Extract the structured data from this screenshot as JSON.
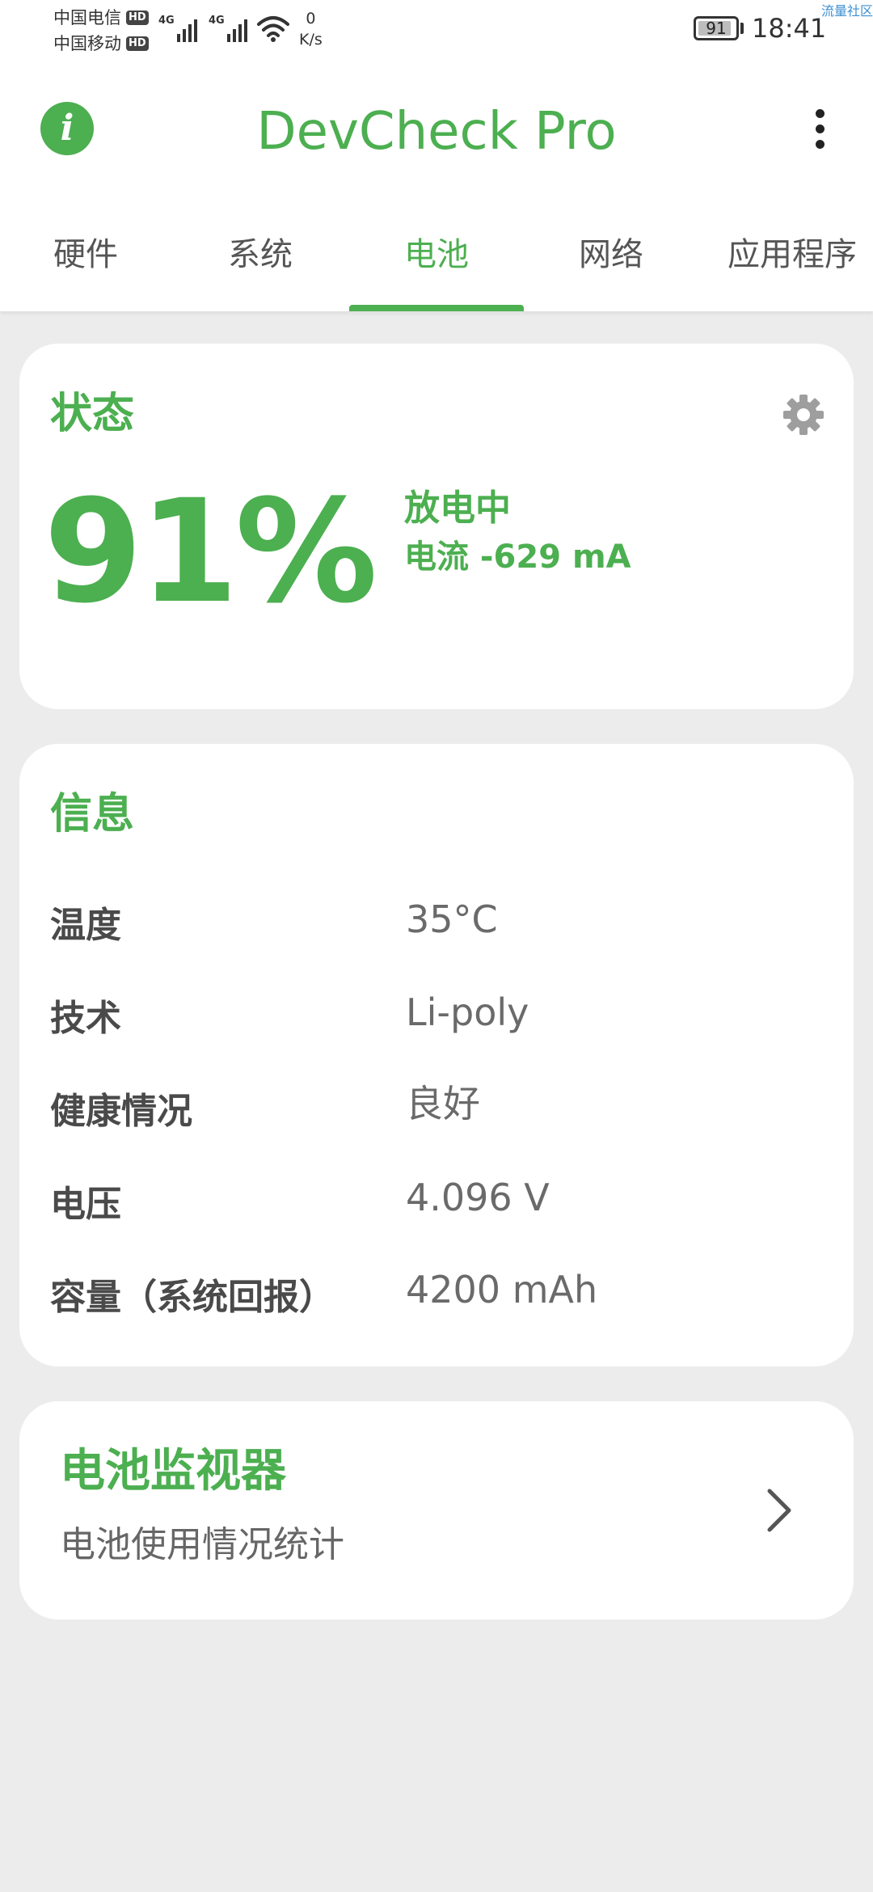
{
  "status_bar": {
    "carrier1": "中国电信",
    "carrier2": "中国移动",
    "hd_badge": "HD",
    "network_type": "4G",
    "net_speed_value": "0",
    "net_speed_unit": "K/s",
    "battery_level": "91",
    "battery_fill_fraction": 0.91,
    "time": "18:41",
    "watermark": "流量社区"
  },
  "app_bar": {
    "title": "DevCheck Pro",
    "info_icon": "info-icon",
    "menu_icon": "more-vert-icon"
  },
  "tabs": [
    {
      "label": "硬件",
      "active": false
    },
    {
      "label": "系统",
      "active": false
    },
    {
      "label": "电池",
      "active": true
    },
    {
      "label": "网络",
      "active": false
    },
    {
      "label": "应用程序",
      "active": false
    }
  ],
  "status_card": {
    "title": "状态",
    "settings_icon": "gear-icon",
    "percent": "91%",
    "state": "放电中",
    "current": "电流 -629 mA"
  },
  "info_card": {
    "title": "信息",
    "rows": [
      {
        "label": "温度",
        "value": "35°C"
      },
      {
        "label": "技术",
        "value": "Li-poly"
      },
      {
        "label": "健康情况",
        "value": "良好"
      },
      {
        "label": "电压",
        "value": "4.096 V"
      },
      {
        "label": "容量（系统回报）",
        "value": "4200 mAh"
      }
    ]
  },
  "monitor_card": {
    "title": "电池监视器",
    "subtitle": "电池使用情况统计",
    "chevron_icon": "chevron-right-icon"
  },
  "colors": {
    "accent": "#4caf50",
    "background": "#ececec",
    "card": "#ffffff"
  }
}
